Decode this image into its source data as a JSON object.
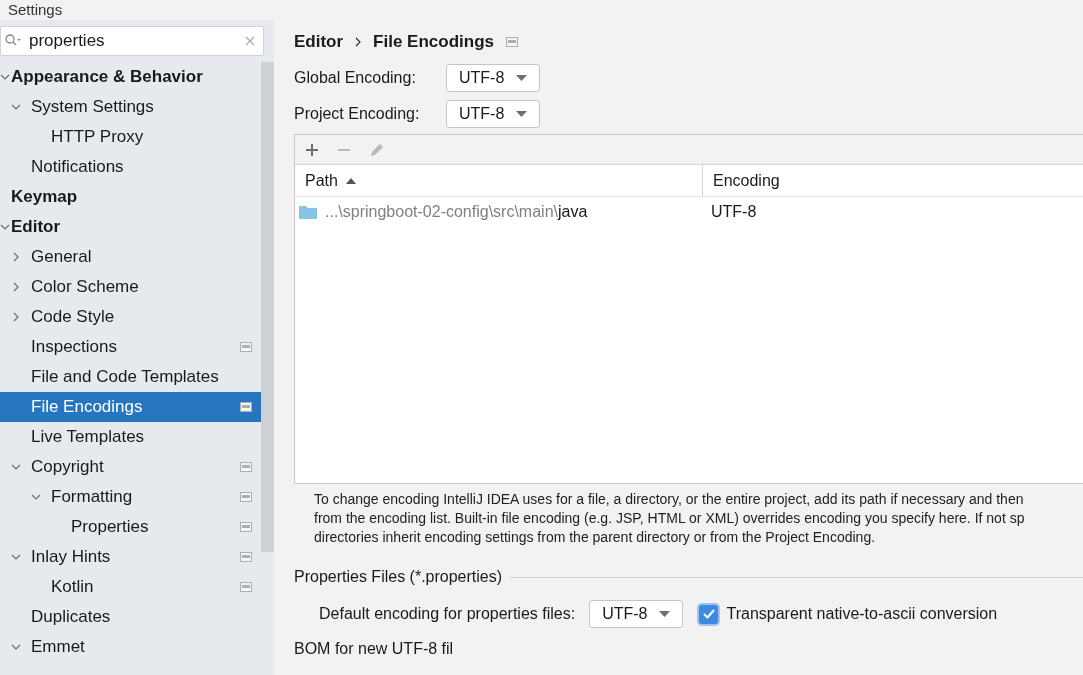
{
  "window": {
    "title": "Settings"
  },
  "search": {
    "value": "properties"
  },
  "tree": [
    {
      "label": "Appearance & Behavior",
      "expanded": true,
      "selected": false,
      "badge": false,
      "children": [
        {
          "label": "System Settings",
          "expanded": true,
          "selected": false,
          "badge": false,
          "children": [
            {
              "label": "HTTP Proxy",
              "selected": false,
              "badge": false
            }
          ]
        },
        {
          "label": "Notifications",
          "selected": false,
          "badge": false
        }
      ]
    },
    {
      "label": "Keymap",
      "selected": false,
      "badge": false
    },
    {
      "label": "Editor",
      "expanded": true,
      "selected": false,
      "badge": false,
      "children": [
        {
          "label": "General",
          "expanded": false,
          "selected": false,
          "badge": false
        },
        {
          "label": "Color Scheme",
          "expanded": false,
          "selected": false,
          "badge": false
        },
        {
          "label": "Code Style",
          "expanded": false,
          "selected": false,
          "badge": false
        },
        {
          "label": "Inspections",
          "selected": false,
          "badge": true
        },
        {
          "label": "File and Code Templates",
          "selected": false,
          "badge": false
        },
        {
          "label": "File Encodings",
          "selected": true,
          "badge": true
        },
        {
          "label": "Live Templates",
          "selected": false,
          "badge": false
        },
        {
          "label": "Copyright",
          "expanded": true,
          "selected": false,
          "badge": true,
          "children": [
            {
              "label": "Formatting",
              "expanded": true,
              "selected": false,
              "badge": true,
              "children": [
                {
                  "label": "Properties",
                  "selected": false,
                  "badge": true
                }
              ]
            }
          ]
        },
        {
          "label": "Inlay Hints",
          "expanded": true,
          "selected": false,
          "badge": true,
          "children": [
            {
              "label": "Kotlin",
              "selected": false,
              "badge": true
            }
          ]
        },
        {
          "label": "Duplicates",
          "selected": false,
          "badge": false
        },
        {
          "label": "Emmet",
          "expanded": true,
          "selected": false,
          "badge": false
        }
      ]
    }
  ],
  "breadcrumb": [
    "Editor",
    "File Encodings"
  ],
  "global_encoding": {
    "label": "Global Encoding:",
    "value": "UTF-8"
  },
  "project_encoding": {
    "label": "Project Encoding:",
    "value": "UTF-8"
  },
  "toolbar": [
    {
      "kind": "add",
      "disabled": false
    },
    {
      "kind": "remove",
      "disabled": true
    },
    {
      "kind": "edit",
      "disabled": true
    }
  ],
  "table": {
    "columns": [
      {
        "label": "Path",
        "sorted": true
      },
      {
        "label": "Encoding",
        "sorted": false
      }
    ],
    "rows": [
      {
        "path_prefix": "...\\springboot-02-config\\src\\main\\",
        "path_name": "java",
        "encoding": "UTF-8"
      }
    ]
  },
  "help_text": "To change encoding IntelliJ IDEA uses for a file, a directory, or the entire project, add its path if necessary and then\nfrom the encoding list. Built-in file encoding (e.g. JSP, HTML or XML) overrides encoding you specify here. If not sp\ndirectories inherit encoding settings from the parent directory or from the Project Encoding.",
  "properties_section": {
    "title": "Properties Files (*.properties)",
    "default_label": "Default encoding for properties files:",
    "default_value": "UTF-8",
    "transparent": {
      "label": "Transparent native-to-ascii conversion",
      "checked": true
    }
  },
  "bom_label": "BOM for new UTF-8 fil"
}
